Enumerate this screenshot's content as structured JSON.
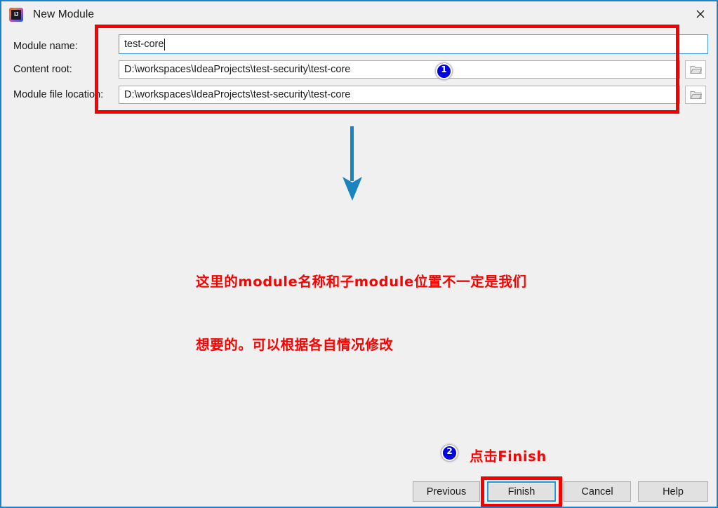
{
  "window": {
    "title": "New Module",
    "app_icon": "intellij-idea-icon",
    "close_icon": "close-icon",
    "border_color": "#1f82c8",
    "background_color": "#f0f0f0"
  },
  "form": {
    "fields": [
      {
        "label": "Module name:",
        "value": "test-core",
        "placeholder": "",
        "focused": true,
        "has_browse": false
      },
      {
        "label": "Content root:",
        "value": "D:\\workspaces\\IdeaProjects\\test-security\\test-core",
        "placeholder": "",
        "focused": false,
        "has_browse": true,
        "browse_icon": "folder-icon"
      },
      {
        "label": "Module file location:",
        "value": "D:\\workspaces\\IdeaProjects\\test-security\\test-core",
        "placeholder": "",
        "focused": false,
        "has_browse": true,
        "browse_icon": "folder-icon"
      }
    ]
  },
  "annotations": {
    "highlight_color": "#f40000",
    "badge_color": "#0000e0",
    "arrow_color": "#1884c0",
    "badges": [
      {
        "number": "1"
      },
      {
        "number": "2"
      }
    ],
    "notes": [
      {
        "line1": "这里的module名称和子module位置不一定是我们",
        "line2": "想要的。可以根据各自情况修改"
      },
      {
        "text": "点击Finish"
      }
    ],
    "arrow_icon": "down-arrow-icon"
  },
  "buttons": {
    "previous": "Previous",
    "finish": "Finish",
    "cancel": "Cancel",
    "help": "Help"
  }
}
